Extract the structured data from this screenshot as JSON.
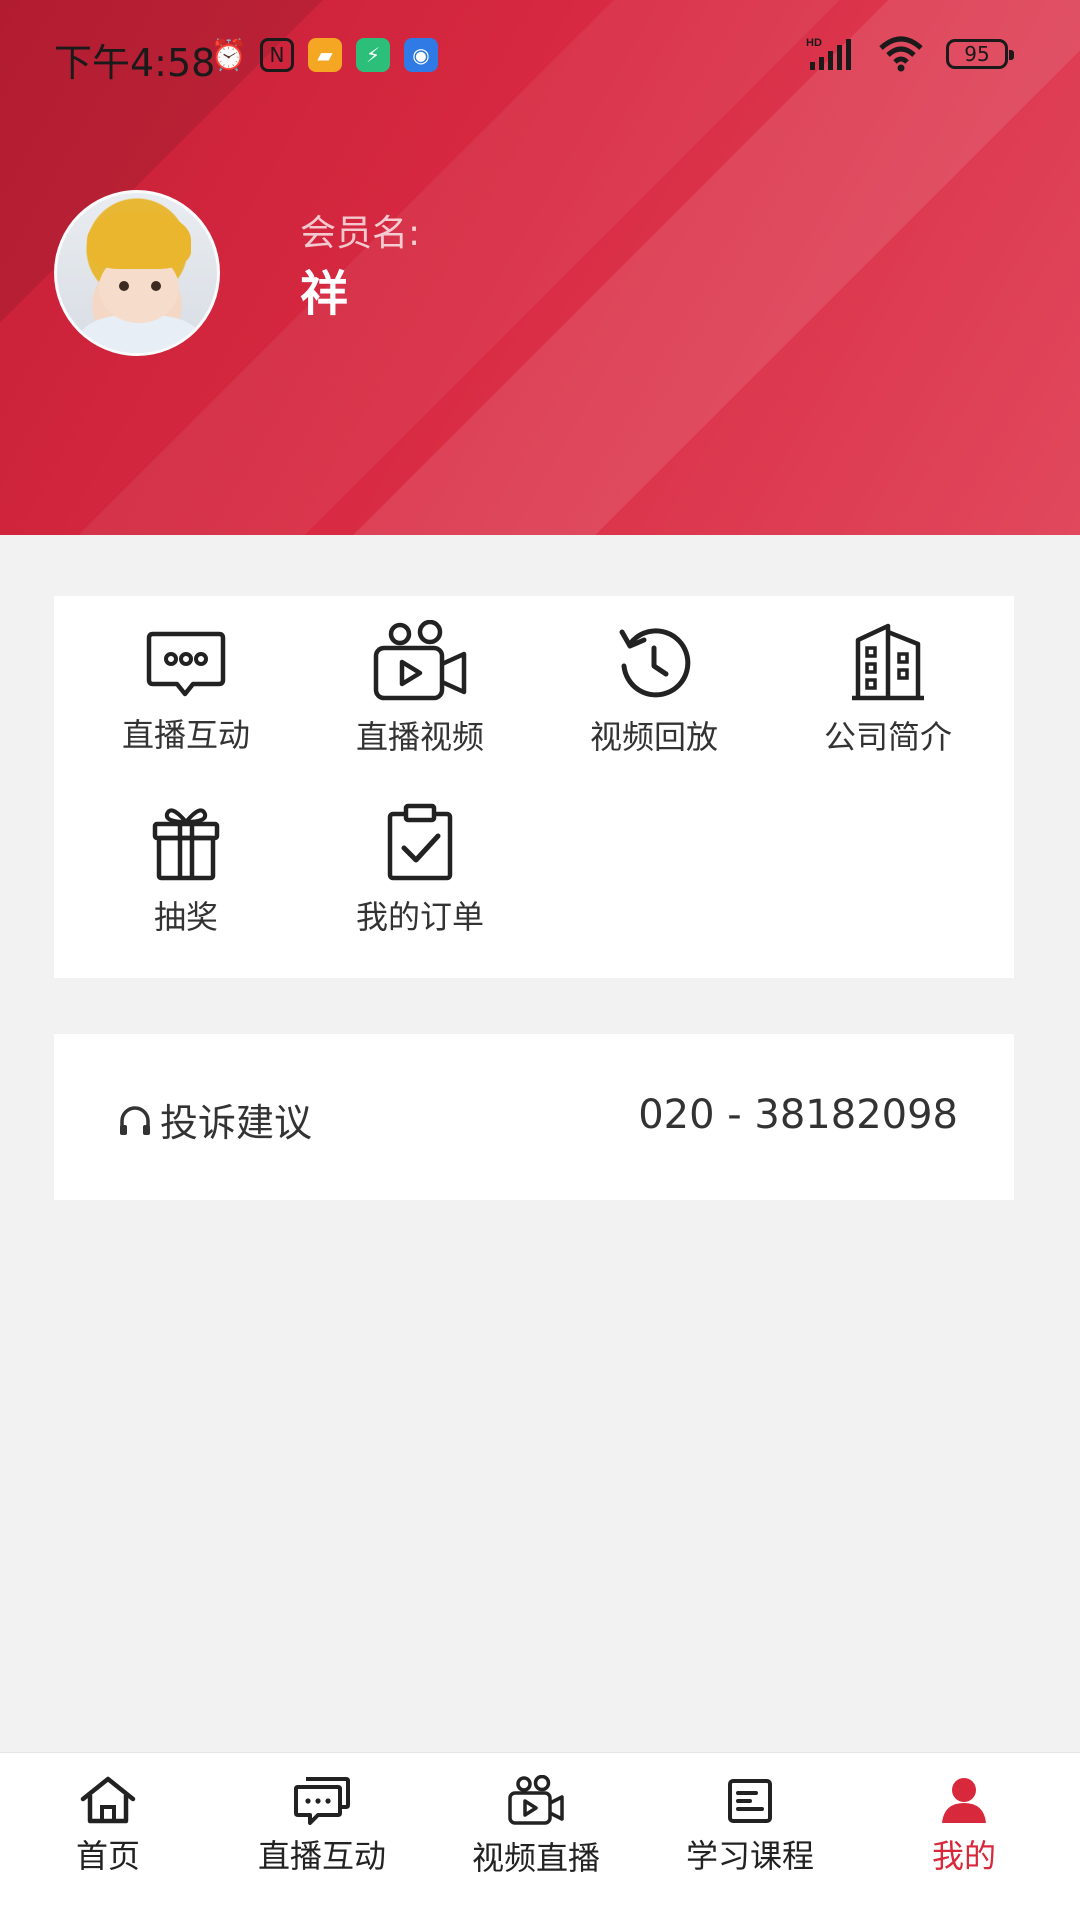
{
  "status_bar": {
    "time": "下午4:58",
    "signal_label": "HD",
    "battery": "95"
  },
  "profile": {
    "member_label": "会员名:",
    "member_name": "祥"
  },
  "menu": {
    "items": [
      {
        "label": "直播互动",
        "icon": "chat-bubble-icon"
      },
      {
        "label": "直播视频",
        "icon": "video-camera-icon"
      },
      {
        "label": "视频回放",
        "icon": "replay-icon"
      },
      {
        "label": "公司简介",
        "icon": "building-icon"
      },
      {
        "label": "抽奖",
        "icon": "gift-icon"
      },
      {
        "label": "我的订单",
        "icon": "clipboard-check-icon"
      }
    ]
  },
  "complaint": {
    "label": "投诉建议",
    "phone": "020 - 38182098",
    "icon": "headphone-icon"
  },
  "bottom_nav": {
    "items": [
      {
        "label": "首页",
        "icon": "home-icon",
        "active": false
      },
      {
        "label": "直播互动",
        "icon": "chat-bubble-icon",
        "active": false
      },
      {
        "label": "视频直播",
        "icon": "video-camera-icon",
        "active": false
      },
      {
        "label": "学习课程",
        "icon": "course-icon",
        "active": false
      },
      {
        "label": "我的",
        "icon": "user-icon",
        "active": true
      }
    ]
  },
  "colors": {
    "brand_red": "#d8283c",
    "header_red": "#d82a42",
    "background": "#f2f2f2"
  }
}
